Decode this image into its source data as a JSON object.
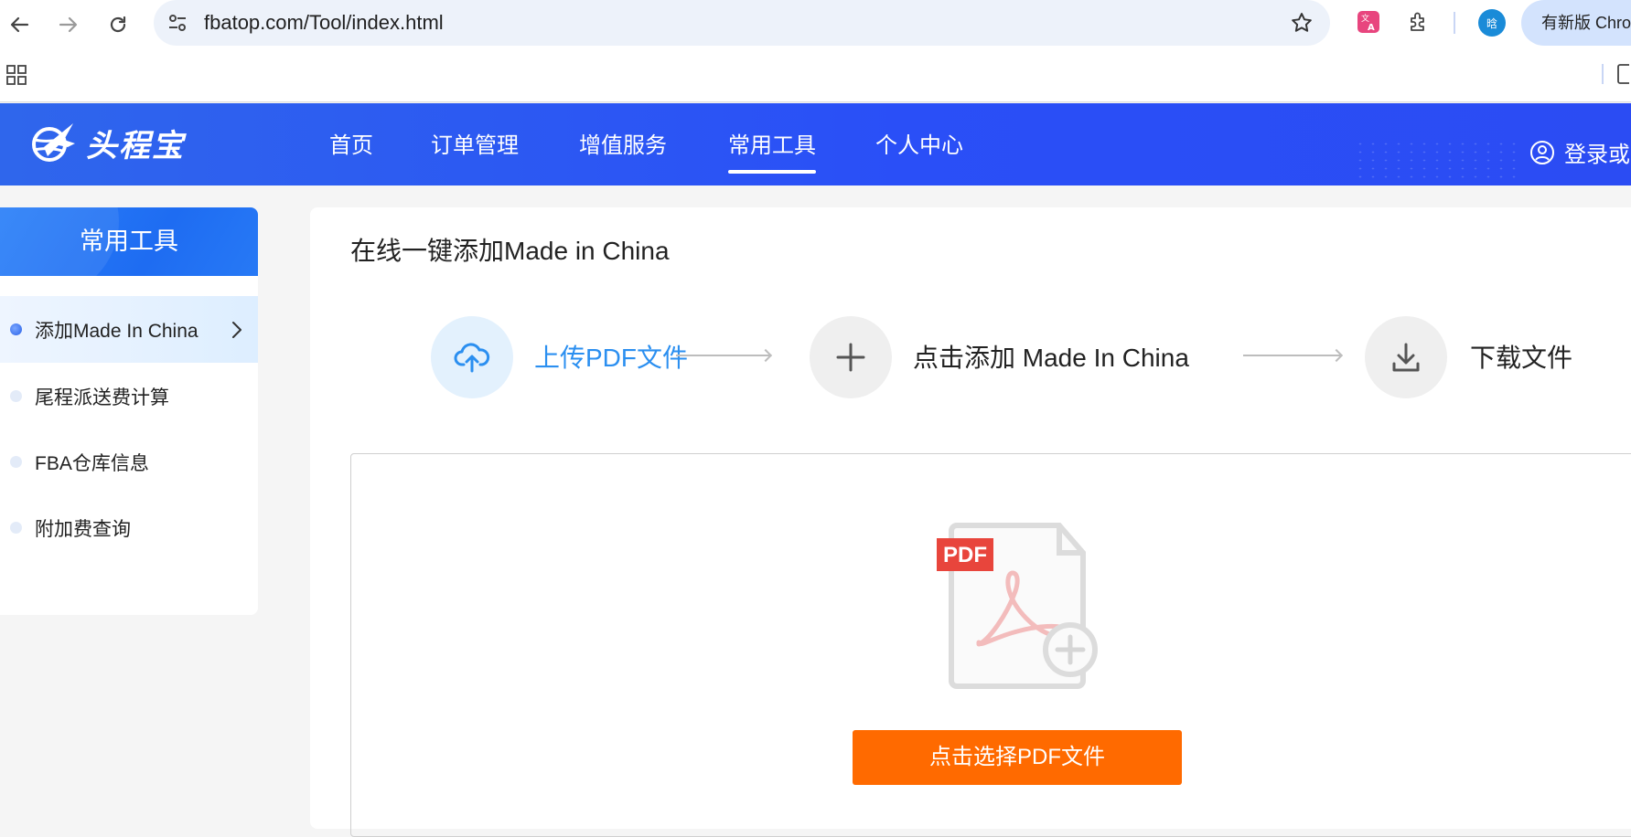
{
  "browser": {
    "url": "fbatop.com/Tool/index.html",
    "profile_initial": "晗",
    "update_label": "有新版 Chrome"
  },
  "header": {
    "logo_text": "头程宝",
    "nav": [
      {
        "label": "首页",
        "active": false
      },
      {
        "label": "订单管理",
        "active": false
      },
      {
        "label": "增值服务",
        "active": false
      },
      {
        "label": "常用工具",
        "active": true
      },
      {
        "label": "个人中心",
        "active": false
      }
    ],
    "login_label": "登录或"
  },
  "sidebar": {
    "title": "常用工具",
    "items": [
      {
        "label": "添加Made In China",
        "active": true
      },
      {
        "label": "尾程派送费计算",
        "active": false
      },
      {
        "label": "FBA仓库信息",
        "active": false
      },
      {
        "label": "附加费查询",
        "active": false
      }
    ]
  },
  "main": {
    "title": "在线一键添加Made in China",
    "steps": [
      {
        "label": "上传PDF文件",
        "icon": "cloud-upload-icon",
        "active": true
      },
      {
        "label": "点击添加 Made In China",
        "icon": "plus-icon",
        "active": false
      },
      {
        "label": "下载文件",
        "icon": "download-icon",
        "active": false
      }
    ],
    "upload": {
      "badge": "PDF",
      "button_label": "点击选择PDF文件"
    }
  },
  "colors": {
    "header_blue": "#2a4ff7",
    "accent_blue": "#2b8ff0",
    "button_orange": "#ff6a00"
  }
}
